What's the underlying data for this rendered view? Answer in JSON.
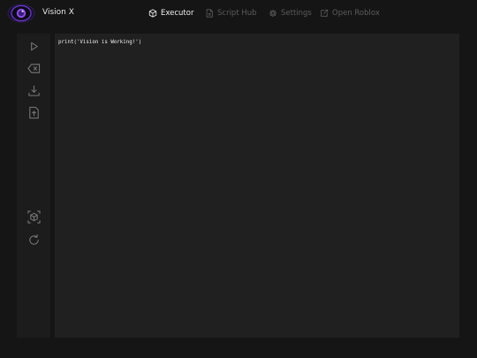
{
  "header": {
    "title": "Vision X",
    "logo_icon": "eye-logo-icon",
    "accent_color": "#8a4fe0"
  },
  "nav": {
    "executor": {
      "label": "Executor",
      "icon": "cube-icon",
      "active": true
    },
    "script_hub": {
      "label": "Script Hub",
      "icon": "document-icon",
      "active": false
    },
    "settings": {
      "label": "Settings",
      "icon": "gear-icon",
      "active": false
    },
    "open_roblox": {
      "label": "Open Roblox",
      "icon": "external-link-icon",
      "active": false
    }
  },
  "sidebar": {
    "buttons": [
      {
        "name": "execute",
        "icon": "play-icon"
      },
      {
        "name": "clear",
        "icon": "backspace-icon"
      },
      {
        "name": "open-file",
        "icon": "download-icon"
      },
      {
        "name": "save-file",
        "icon": "upload-icon"
      },
      {
        "name": "inject",
        "icon": "cube-scan-icon"
      },
      {
        "name": "refresh",
        "icon": "refresh-icon"
      }
    ]
  },
  "editor": {
    "code": "print('Vision is Working!')"
  }
}
